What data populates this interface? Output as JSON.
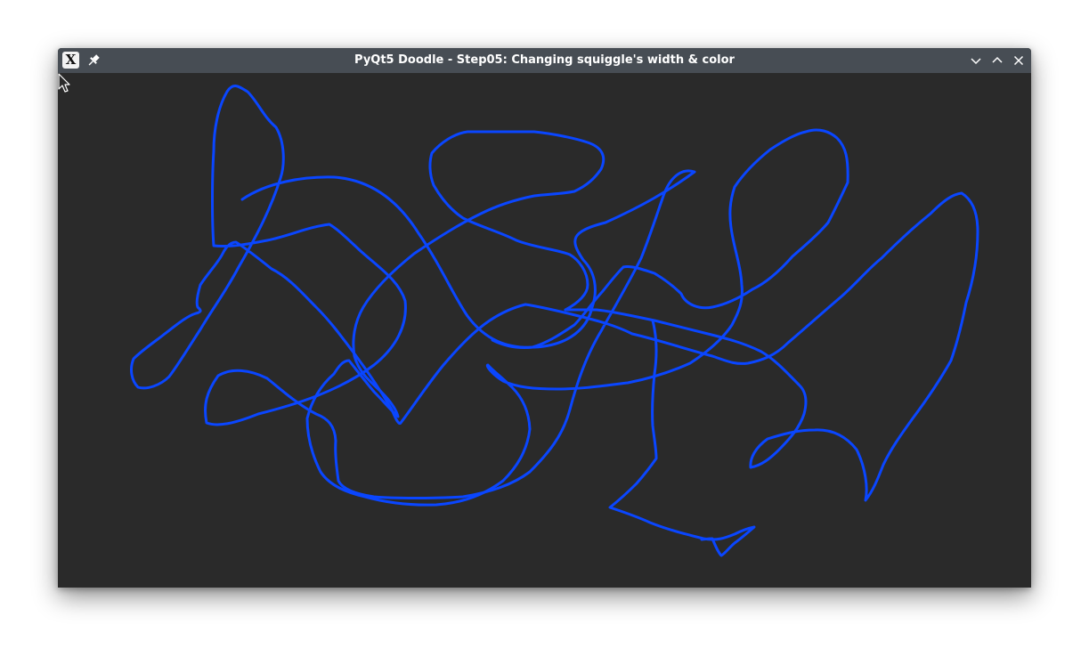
{
  "window": {
    "title": "PyQt5 Doodle - Step05: Changing squiggle's width & color",
    "app_icon": "x-app-icon",
    "icons": {
      "pin": "pin-icon",
      "minimize": "chevron-down-icon",
      "maximize": "chevron-up-icon",
      "close": "close-icon"
    }
  },
  "canvas": {
    "background": "#2a2a2a",
    "pen_color": "#0a46ff",
    "cursor": "arrow-cursor-icon"
  },
  "colors": {
    "titlebar": "#474d54",
    "title_text": "#ffffff"
  }
}
